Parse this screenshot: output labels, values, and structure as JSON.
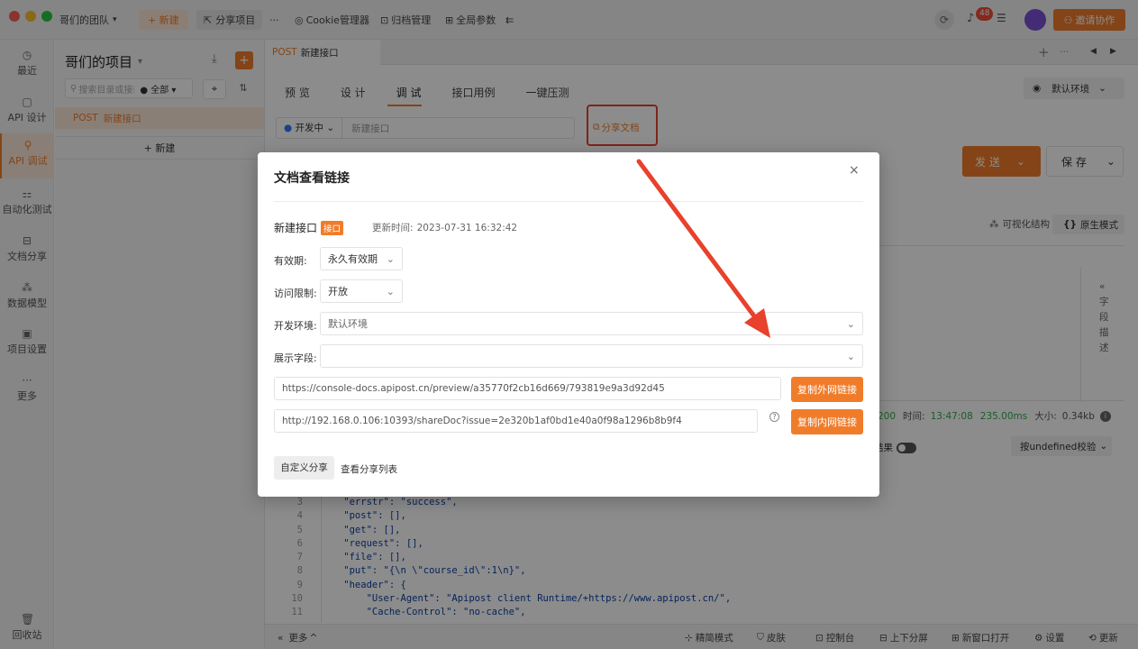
{
  "titlebar": {
    "team": "哥们的团队",
    "new_label": "+ 新建",
    "share_project": "分享项目",
    "more": "···",
    "cookie": "Cookie管理器",
    "archive": "归档管理",
    "global_params": "全局参数",
    "notif_count": "48",
    "invite": "邀请协作"
  },
  "leftnav": {
    "items": [
      {
        "label": "最近",
        "icon": "clock-icon"
      },
      {
        "label": "API 设计",
        "icon": "design-icon"
      },
      {
        "label": "API 调试",
        "icon": "debug-icon"
      },
      {
        "label": "自动化测试",
        "icon": "automation-icon"
      },
      {
        "label": "文档分享",
        "icon": "doc-share-icon"
      },
      {
        "label": "数据模型",
        "icon": "model-icon"
      },
      {
        "label": "项目设置",
        "icon": "settings-icon"
      },
      {
        "label": "更多",
        "icon": "more-icon"
      }
    ],
    "trash": "回收站"
  },
  "project": {
    "title": "哥们的项目",
    "search_placeholder": "搜索目录或接口",
    "filter": "全部",
    "api_method": "POST",
    "api_name": "新建接口",
    "new_btn": "+ 新建"
  },
  "main": {
    "tab_method": "POST",
    "tab_name": "新建接口",
    "subtabs": [
      "预 览",
      "设 计",
      "调 试",
      "接口用例",
      "一键压测"
    ],
    "env": "默认环境",
    "status_label": "开发中",
    "api_name_placeholder": "新建接口",
    "share_doc": "分享文档",
    "send": "发 送",
    "save": "保 存",
    "visual": "可视化结构",
    "raw": "原生模式",
    "field_desc": "字段描述",
    "resp_status": "200",
    "resp_time_label": "时间:",
    "resp_time": "13:47:08",
    "resp_duration": "235.00ms",
    "resp_size_label": "大小:",
    "resp_size": "0.34kb",
    "result_label": "结果",
    "verify": "按undefined校验",
    "code_lines": [
      {
        "n": "3",
        "t": "    \"errstr\": \"success\","
      },
      {
        "n": "4",
        "t": "    \"post\": [],"
      },
      {
        "n": "5",
        "t": "    \"get\": [],"
      },
      {
        "n": "6",
        "t": "    \"request\": [],"
      },
      {
        "n": "7",
        "t": "    \"file\": [],"
      },
      {
        "n": "8",
        "t": "    \"put\": \"{\\n \\\"course_id\\\":1\\n}\","
      },
      {
        "n": "9",
        "t": "    \"header\": {"
      },
      {
        "n": "10",
        "t": "        \"User-Agent\": \"Apipost client Runtime/+https://www.apipost.cn/\","
      },
      {
        "n": "11",
        "t": "        \"Cache-Control\": \"no-cache\","
      }
    ]
  },
  "bottombar": {
    "more": "更多",
    "simple": "精简模式",
    "skin": "皮肤",
    "console": "控制台",
    "split": "上下分屏",
    "new_window": "新窗口打开",
    "settings": "设置",
    "update": "更新"
  },
  "modal": {
    "title": "文档查看链接",
    "api_name": "新建接口",
    "api_tag": "接口",
    "updated_label": "更新时间:",
    "updated_time": "2023-07-31 16:32:42",
    "validity_label": "有效期:",
    "validity_value": "永久有效期",
    "access_label": "访问限制:",
    "access_value": "开放",
    "env_label": "开发环境:",
    "env_value": "默认环境",
    "fields_label": "展示字段:",
    "external_url": "https://console-docs.apipost.cn/preview/a35770f2cb16d669/793819e9a3d92d45",
    "copy_external": "复制外网链接",
    "internal_url": "http://192.168.0.106:10393/shareDoc?issue=2e320b1af0bd1e40a0f98a1296b8b9f4",
    "copy_internal": "复制内网链接",
    "custom_share": "自定义分享",
    "view_share_list": "查看分享列表"
  },
  "colors": {
    "accent": "#f07c2a",
    "annotation_red": "#e8412c"
  }
}
